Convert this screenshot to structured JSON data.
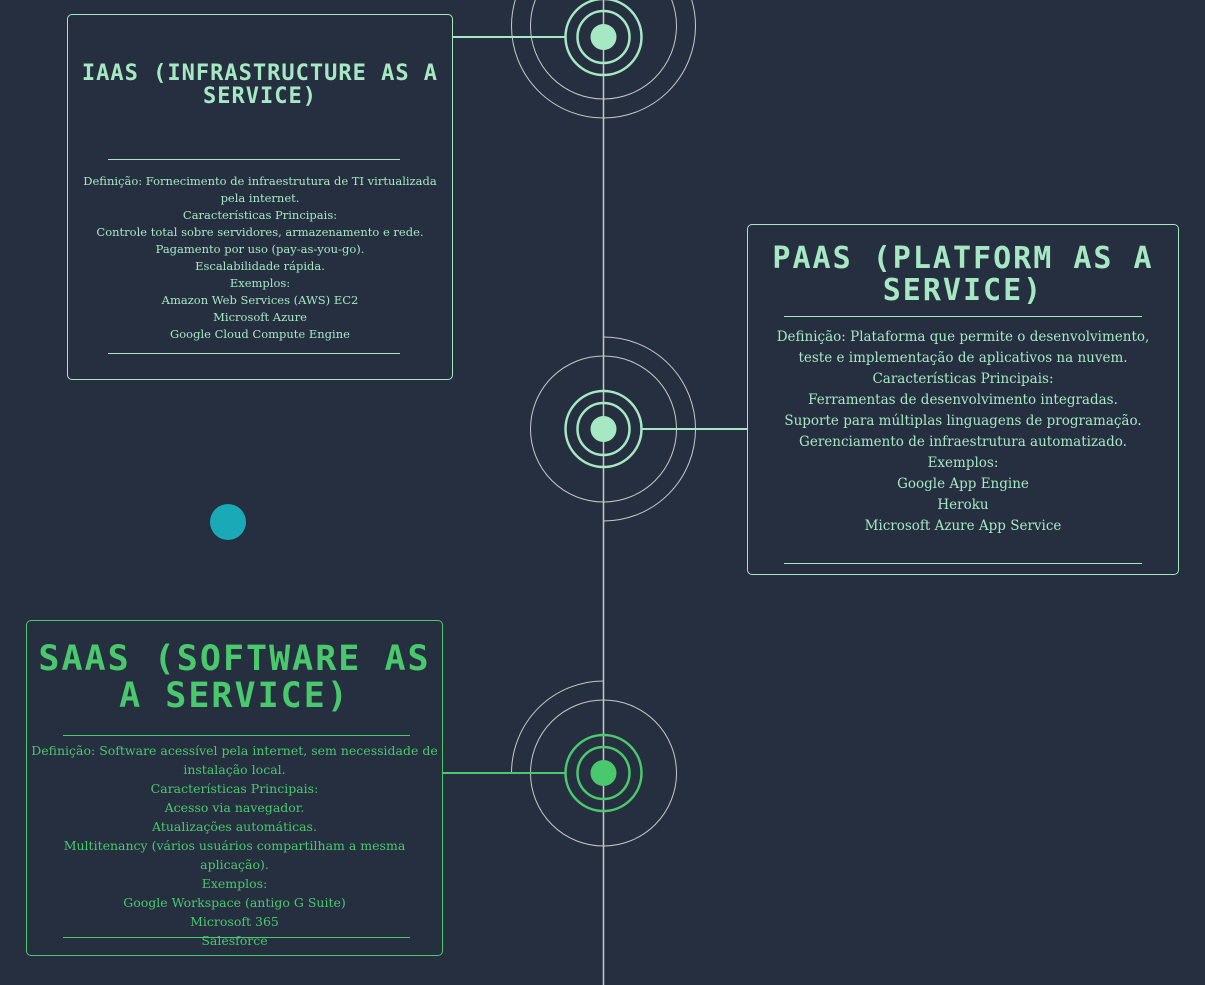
{
  "colors": {
    "background": "#252f3f",
    "mint": "#a6e8c4",
    "green": "#4ac86d",
    "teal": "#1aa9b7",
    "line": "#c7c9cc"
  },
  "cards": [
    {
      "id": "iaas",
      "title": "IaaS (Infrastructure as a Service)",
      "lines": [
        "Definição: Fornecimento de infraestrutura de TI virtualizada pela internet.",
        "Características Principais:",
        "Controle total sobre servidores, armazenamento e rede.",
        "Pagamento por uso (pay-as-you-go).",
        "Escalabilidade rápida.",
        "Exemplos:",
        "Amazon Web Services (AWS) EC2",
        "Microsoft Azure",
        "Google Cloud Compute Engine"
      ]
    },
    {
      "id": "paas",
      "title": "PaaS (Platform as a Service)",
      "lines": [
        "Definição: Plataforma que permite o desenvolvimento, teste e implementação de aplicativos na nuvem.",
        "Características Principais:",
        "Ferramentas de desenvolvimento integradas.",
        "Suporte para múltiplas linguagens de programação.",
        "Gerenciamento de infraestrutura automatizado.",
        "Exemplos:",
        "Google App Engine",
        "Heroku",
        "Microsoft Azure App Service"
      ]
    },
    {
      "id": "saas",
      "title": "SaaS (Software as a Service)",
      "lines": [
        "Definição: Software acessível pela internet, sem necessidade de instalação local.",
        "Características Principais:",
        "Acesso via navegador.",
        "Atualizações automáticas.",
        "Multitenancy (vários usuários compartilham a mesma aplicação).",
        "Exemplos:",
        "Google Workspace (antigo G Suite)",
        "Microsoft 365",
        "Salesforce"
      ]
    }
  ]
}
